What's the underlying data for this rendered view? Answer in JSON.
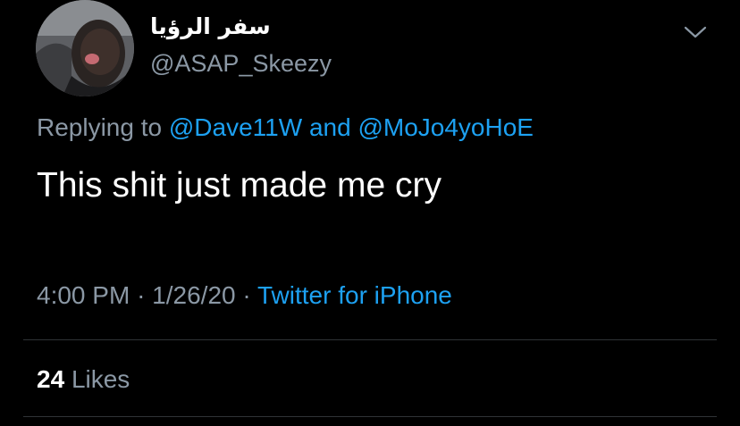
{
  "colors": {
    "background": "#000000",
    "primary_text": "#ffffff",
    "secondary_text": "#8b98a5",
    "link": "#1da1f2",
    "divider": "#2f3336"
  },
  "author": {
    "avatar": "profile-photo",
    "display_name": "سفر الرؤيا",
    "handle": "@ASAP_Skeezy"
  },
  "menu_icon": "chevron-down-icon",
  "replying": {
    "prefix": "Replying to",
    "user1": "@Dave11W",
    "conjunction": "and",
    "user2": "@MoJo4yoHoE"
  },
  "tweet": {
    "text": "This shit just made me cry"
  },
  "meta": {
    "time": "4:00 PM",
    "separator": "·",
    "date": "1/26/20",
    "source": "Twitter for iPhone"
  },
  "stats": {
    "likes_count": "24",
    "likes_label": "Likes"
  }
}
